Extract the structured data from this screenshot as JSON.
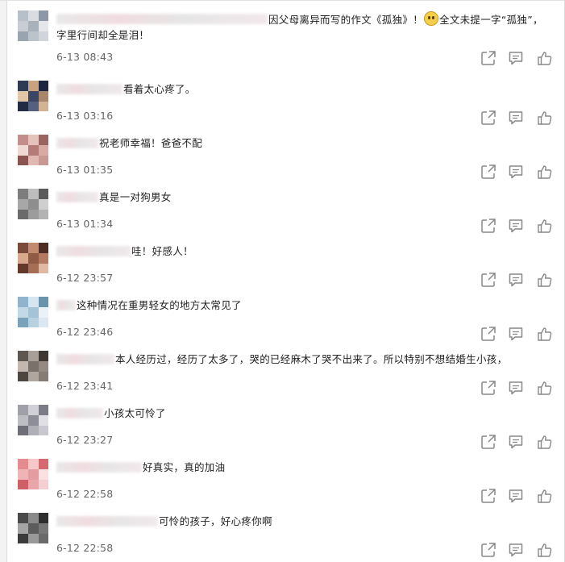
{
  "comments": [
    {
      "text": "因父母离异而写的作文《孤独》！",
      "text_after_emoji": "全文未提一字“孤独”，",
      "text_line2": "字里行间却全是泪！",
      "time": "6-13 08:43",
      "emoji": "crying-face-emoji"
    },
    {
      "text": "看着太心疼了。",
      "time": "6-13 03:16"
    },
    {
      "text": "祝老师幸福！爸爸不配",
      "time": "6-13 01:35"
    },
    {
      "text": "真是一对狗男女",
      "time": "6-13 01:34"
    },
    {
      "text": "哇！好感人！",
      "time": "6-12 23:57"
    },
    {
      "text": "这种情况在重男轻女的地方太常见了",
      "time": "6-12 23:46"
    },
    {
      "text": "本人经历过，经历了太多了，哭的已经麻木了哭不出来了。所以特别不想结婚生小孩，",
      "time": "6-12 23:41"
    },
    {
      "text": "小孩太可怜了",
      "time": "6-12 23:27"
    },
    {
      "text": "好真实，真的加油",
      "time": "6-12 22:58"
    },
    {
      "text": "可怜的孩子，好心疼你啊",
      "time": "6-12 22:58"
    }
  ],
  "icons": {
    "share": "share-icon",
    "reply": "comment-icon",
    "like": "thumbs-up-icon"
  },
  "colors": {
    "text": "#222222",
    "time": "#666666",
    "icon": "#888888"
  }
}
